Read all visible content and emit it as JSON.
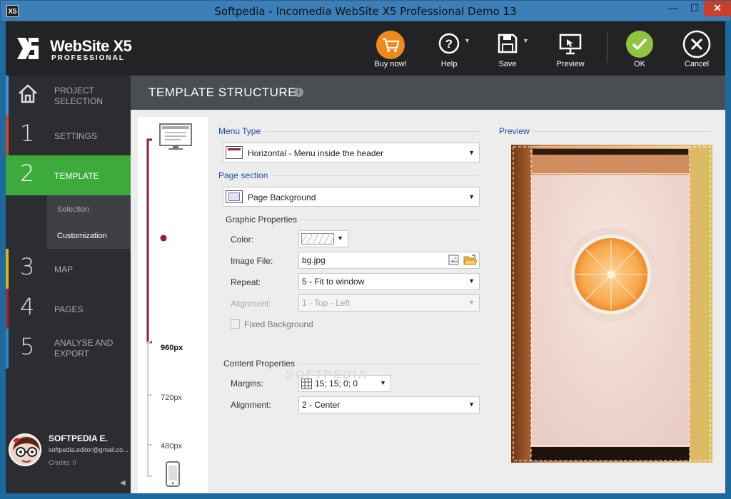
{
  "window": {
    "title": "Softpedia - Incomedia WebSite X5 Professional Demo 13",
    "app_icon": "X5",
    "minimize": "—",
    "maximize": "☐",
    "close": "✕"
  },
  "logo": {
    "name": "WebSite X5",
    "edition": "PROFESSIONAL"
  },
  "toolbar": {
    "buy": "Buy now!",
    "help": "Help",
    "save": "Save",
    "preview": "Preview",
    "ok": "OK",
    "cancel": "Cancel"
  },
  "nav": {
    "items": [
      {
        "number": "",
        "label": "PROJECT\nSELECTION",
        "l1": "PROJECT",
        "l2": "SELECTION",
        "accent": "#4a8fd0"
      },
      {
        "number": "1",
        "label": "SETTINGS",
        "accent": "#c9482c"
      },
      {
        "number": "2",
        "label": "TEMPLATE",
        "accent": "#3cab3c"
      },
      {
        "number": "3",
        "label": "MAP",
        "accent": "#e0b020"
      },
      {
        "number": "4",
        "label": "PAGES",
        "accent": "#9a2a3a"
      },
      {
        "number": "5",
        "label": "ANALYSE AND\nEXPORT",
        "l1": "ANALYSE AND",
        "l2": "EXPORT",
        "accent": "#2a8ac0"
      }
    ],
    "sub": [
      "Selection",
      "Customization"
    ]
  },
  "user": {
    "name": "SOFTPEDIA E.",
    "email": "softpedia.editor@gmail.co...",
    "credits": "Credits: 0"
  },
  "content": {
    "title": "TEMPLATE STRUCTURE",
    "info": "i"
  },
  "ruler": {
    "labels": [
      "960px",
      "720px",
      "480px"
    ]
  },
  "form": {
    "menu_type_title": "Menu Type",
    "menu_type": "Horizontal - Menu inside the header",
    "page_section_title": "Page section",
    "page_section": "Page Background",
    "graphic_title": "Graphic Properties",
    "color_label": "Color:",
    "image_label": "Image File:",
    "image_value": "bg.jpg",
    "repeat_label": "Repeat:",
    "repeat_value": "5 - Fit to window",
    "alignment_label": "Alignment:",
    "alignment_value": "1 - Top - Left",
    "fixed_bg": "Fixed Background",
    "content_title": "Content Properties",
    "margins_label": "Margins:",
    "margins_value": "15; 15; 0; 0",
    "content_align_label": "Alignment:",
    "content_align_value": "2 - Center"
  },
  "preview_title": "Preview",
  "watermark": "SOFTPEDIA",
  "colors": {
    "accent_green": "#3cab3c",
    "buy_orange": "#f08a1e",
    "ok_green": "#8fc43f",
    "ruler_line": "#9b1650",
    "section_blue": "#1f4e9a"
  }
}
